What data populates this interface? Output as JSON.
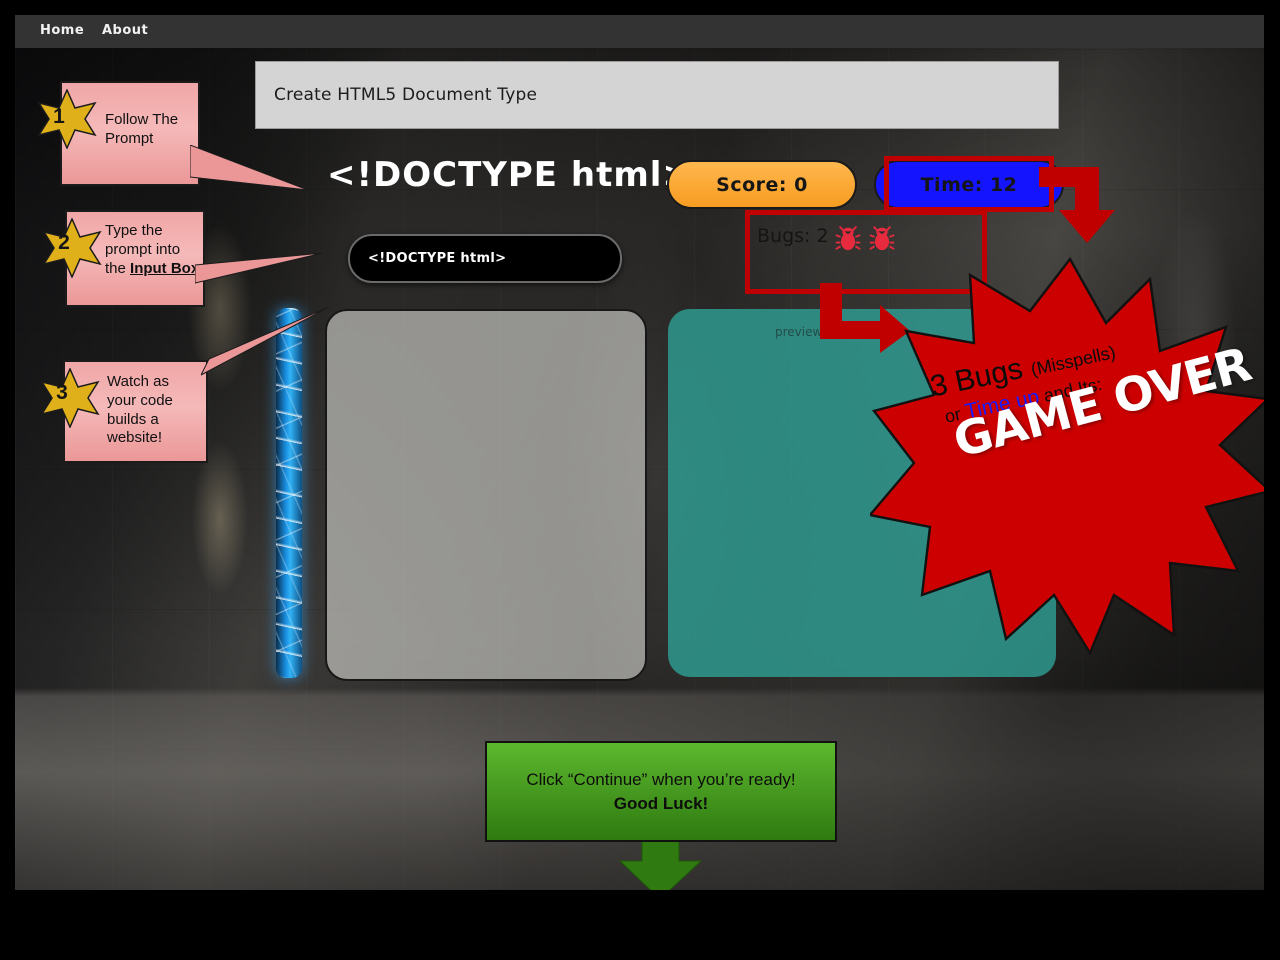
{
  "nav": {
    "items": [
      {
        "label": "Home"
      },
      {
        "label": "About"
      }
    ]
  },
  "prompt_bar": {
    "text": "Create HTML5 Document Type"
  },
  "game": {
    "big_title": "<!DOCTYPE html>",
    "score_label": "Score: 0",
    "time_label": "Time: 12",
    "bugs_label": "Bugs: 2",
    "bug_icon_count": 2,
    "input_value": "<!DOCTYPE html>",
    "preview_label": "preview",
    "colors": {
      "score_pill": "#f79c22",
      "time_pill": "#1414ff",
      "bug_icon": "#e82a3e",
      "code_panel": "#d7d6d2",
      "preview_panel": "#2ea096",
      "energy_bar": "#1a8fe0",
      "annotation_red": "#c00000",
      "callout_pink": "#f0a6a6",
      "continue_green": "#5db82e",
      "star_gold": "#d4a017"
    }
  },
  "callouts": [
    {
      "number": "1",
      "text": "Follow The Prompt",
      "icon": "gold-star-badge"
    },
    {
      "number": "2",
      "text_lead": "Type the prompt into the ",
      "text_bold": "Input Box",
      "icon": "gold-star-badge"
    },
    {
      "number": "3",
      "text": "Watch as your code builds a website!",
      "icon": "gold-star-badge"
    }
  ],
  "starburst": {
    "line1_big": "3 Bugs ",
    "line1_small": "(Misspells)",
    "line2_pre": "or ",
    "line2_blue": "Time up",
    "line2_post": " and Its:",
    "game_over": "GAME OVER"
  },
  "continue_note": {
    "line1": "Click “Continue” when you’re ready!",
    "line2": "Good Luck!",
    "arrow_icon": "down-arrow-icon"
  }
}
